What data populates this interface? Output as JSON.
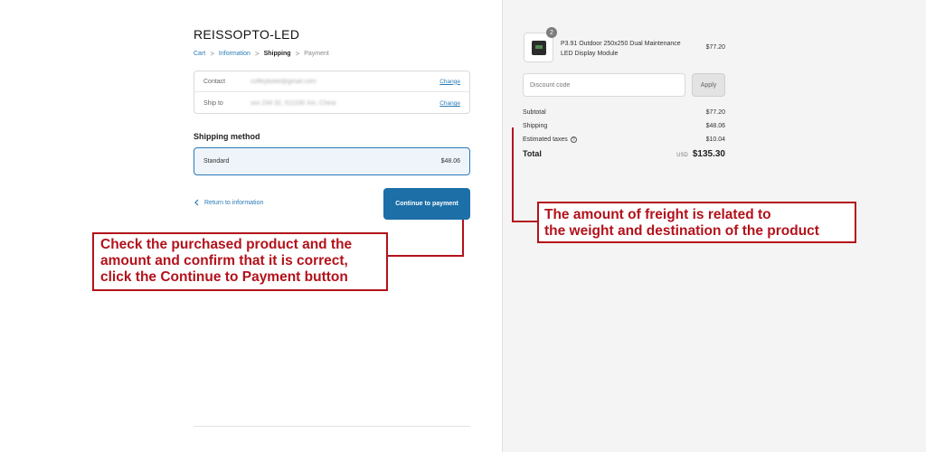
{
  "store": {
    "name": "REISSOPTO-LED"
  },
  "breadcrumb": {
    "cart": "Cart",
    "information": "Information",
    "shipping": "Shipping",
    "payment": "Payment",
    "separator": ">"
  },
  "info": {
    "contact_label": "Contact",
    "contact_value": "coffeyboke@gmail.com",
    "shipto_label": "Ship to",
    "shipto_value": "xxx 234 32, 511100 Xin, China",
    "change_label": "Change"
  },
  "shipping": {
    "title": "Shipping method",
    "method_name": "Standard",
    "method_price": "$48.06"
  },
  "nav": {
    "return_label": "Return to information",
    "continue_label": "Continue to payment"
  },
  "order": {
    "quantity": "2",
    "product_name": "P3.91 Outdoor 250x250 Dual Maintenance LED Display Module",
    "product_price": "$77.20",
    "discount_placeholder": "Discount code",
    "apply_label": "Apply",
    "subtotal_label": "Subtotal",
    "subtotal_value": "$77.20",
    "shipping_label": "Shipping",
    "shipping_value": "$48.06",
    "taxes_label": "Estimated taxes",
    "taxes_value": "$10.04",
    "total_label": "Total",
    "currency": "USD",
    "total_value": "$135.30"
  },
  "annotations": {
    "left_text": "Check the purchased product and the amount and confirm that it is correct, click the Continue to Payment button",
    "right_line1": "The amount of freight is related to",
    "right_line2": "the weight and destination of the product",
    "color": "#b3121b"
  },
  "colors": {
    "accent": "#1d6fa8",
    "link": "#2a7ab8",
    "sidebar_bg": "#f4f4f4"
  }
}
